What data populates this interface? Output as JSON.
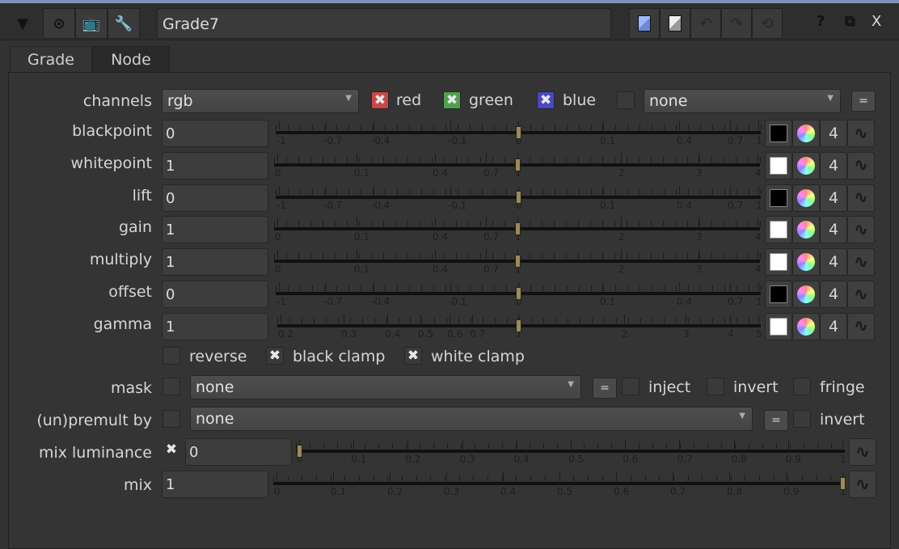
{
  "toolbar": {
    "collapse_icon": "triangle-down",
    "node_name": "Grade7",
    "help": "?",
    "float": "⧉",
    "close": "X"
  },
  "tabs": [
    {
      "label": "Grade"
    },
    {
      "label": "Node"
    }
  ],
  "channels": {
    "label": "channels",
    "value": "rgb",
    "red": "red",
    "green": "green",
    "blue": "blue",
    "extra": "none",
    "eq": "="
  },
  "knobs": [
    {
      "label": "blackpoint",
      "value": "0",
      "num": 0,
      "scale": "bp",
      "ticks": [
        "-1",
        "-0.7",
        "-0.4",
        "-0.1",
        "0",
        "0.1",
        "0.4",
        "0.7",
        "1"
      ],
      "swatch": "#000000",
      "chan": "4"
    },
    {
      "label": "whitepoint",
      "value": "1",
      "num": 1,
      "scale": "wp",
      "ticks": [
        "0",
        "0.1",
        "0.4",
        "0.7",
        "1",
        "2",
        "3",
        "4"
      ],
      "swatch": "#ffffff",
      "chan": "4"
    },
    {
      "label": "lift",
      "value": "0",
      "num": 0,
      "scale": "bp",
      "ticks": [
        "-1",
        "-0.7",
        "-0.4",
        "-0.1",
        "0",
        "0.1",
        "0.4",
        "0.7",
        "1"
      ],
      "swatch": "#000000",
      "chan": "4"
    },
    {
      "label": "gain",
      "value": "1",
      "num": 1,
      "scale": "wp",
      "ticks": [
        "0",
        "0.1",
        "0.4",
        "0.7",
        "1",
        "2",
        "3",
        "4"
      ],
      "swatch": "#ffffff",
      "chan": "4"
    },
    {
      "label": "multiply",
      "value": "1",
      "num": 1,
      "scale": "wp",
      "ticks": [
        "0",
        "0.1",
        "0.4",
        "0.7",
        "1",
        "2",
        "3",
        "4"
      ],
      "swatch": "#ffffff",
      "chan": "4"
    },
    {
      "label": "offset",
      "value": "0",
      "num": 0,
      "scale": "bp",
      "ticks": [
        "-1",
        "-0.7",
        "-0.4",
        "-0.1",
        "0",
        "0.1",
        "0.4",
        "0.7",
        "1"
      ],
      "swatch": "#000000",
      "chan": "4"
    },
    {
      "label": "gamma",
      "value": "1",
      "num": 1,
      "scale": "gm",
      "ticks": [
        "0.2",
        "0.3",
        "0.4",
        "0.5",
        "0.6",
        "0.7",
        "1",
        "2",
        "3",
        "4",
        "5"
      ],
      "swatch": "#ffffff",
      "chan": "4"
    }
  ],
  "options": {
    "reverse": "reverse",
    "black_clamp": "black clamp",
    "white_clamp": "white clamp"
  },
  "mask": {
    "label": "mask",
    "value": "none",
    "eq": "=",
    "inject": "inject",
    "invert": "invert",
    "fringe": "fringe"
  },
  "premult": {
    "label": "(un)premult by",
    "value": "none",
    "eq": "=",
    "invert": "invert"
  },
  "mix_luminance": {
    "label": "mix luminance",
    "value": "0",
    "num": 0,
    "ticks": [
      "0",
      "0.1",
      "0.2",
      "0.3",
      "0.4",
      "0.5",
      "0.6",
      "0.7",
      "0.8",
      "0.9",
      "1"
    ]
  },
  "mix": {
    "label": "mix",
    "value": "1",
    "num": 1,
    "ticks": [
      "0",
      "0.1",
      "0.2",
      "0.3",
      "0.4",
      "0.5",
      "0.6",
      "0.7",
      "0.8",
      "0.9",
      "1"
    ]
  },
  "colors": {
    "red_check": "#c84848",
    "green_check": "#50a050",
    "blue_check": "#4848c0",
    "handle": "#9c8a55"
  }
}
